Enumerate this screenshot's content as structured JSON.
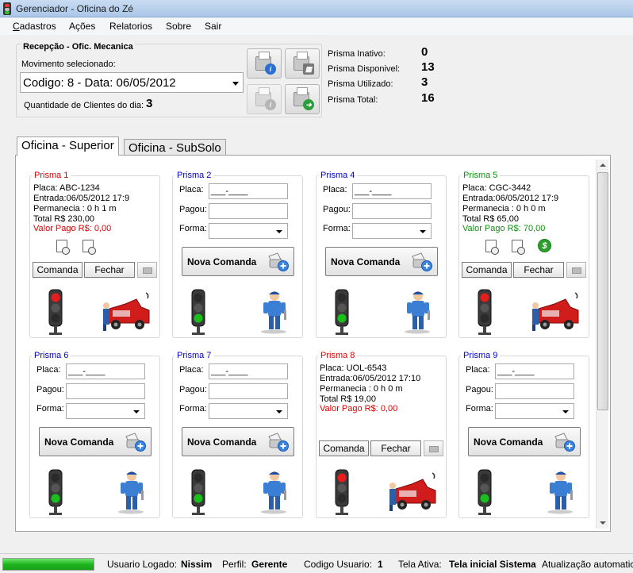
{
  "window": {
    "title": "Gerenciador - Oficina do Zé"
  },
  "menu": [
    "Cadastros",
    "Ações",
    "Relatorios",
    "Sobre",
    "Sair"
  ],
  "recepcao": {
    "group_title": "Recepção - Ofic. Mecanica",
    "movimento_label": "Movimento selecionado:",
    "movimento_value": "Codigo: 8 - Data: 06/05/2012",
    "qtd_label": "Quantidade de Clientes do dia:",
    "qtd_value": "3"
  },
  "stats": [
    {
      "label": "Prisma Inativo:",
      "value": "0"
    },
    {
      "label": "Prisma Disponivel:",
      "value": "13"
    },
    {
      "label": "Prisma Utilizado:",
      "value": "3"
    },
    {
      "label": "Prisma Total:",
      "value": "16"
    }
  ],
  "tabs": [
    "Oficina - Superior",
    "Oficina - SubSolo"
  ],
  "colors": {
    "red": "#e00000",
    "blue": "#0000c8",
    "green": "#109010"
  },
  "cards": [
    {
      "title": "Prisma 1",
      "placa": "Placa: ABC-1234",
      "entrada": "Entrada:06/05/2012 17:9",
      "permanencia": "Permanecia : 0 h 1 m",
      "total": "Total R$ 230,00",
      "valor_pago": "Valor Pago R$: 0,00",
      "comanda": "Comanda",
      "fechar": "Fechar"
    },
    {
      "title": "Prisma 2",
      "placa_label": "Placa:",
      "placa_mask": "___-____",
      "pagou_label": "Pagou:",
      "forma_label": "Forma:",
      "nova": "Nova Comanda"
    },
    {
      "title": "Prisma 4",
      "placa_label": "Placa:",
      "placa_mask": "___-____",
      "pagou_label": "Pagou:",
      "forma_label": "Forma:",
      "nova": "Nova Comanda"
    },
    {
      "title": "Prisma 5",
      "placa": "Placa: CGC-3442",
      "entrada": "Entrada:06/05/2012 17:9",
      "permanencia": "Permanecia : 0 h 0 m",
      "total": "Total R$ 65,00",
      "valor_pago": "Valor Pago R$: 70,00",
      "comanda": "Comanda",
      "fechar": "Fechar"
    },
    {
      "title": "Prisma 6",
      "placa_label": "Placa:",
      "placa_mask": "___-____",
      "pagou_label": "Pagou:",
      "forma_label": "Forma:",
      "nova": "Nova Comanda"
    },
    {
      "title": "Prisma 7",
      "placa_label": "Placa:",
      "placa_mask": "___-____",
      "pagou_label": "Pagou:",
      "forma_label": "Forma:",
      "nova": "Nova Comanda"
    },
    {
      "title": "Prisma 8",
      "placa": "Placa: UOL-6543",
      "entrada": "Entrada:06/05/2012 17:10",
      "permanencia": "Permanecia : 0 h 0 m",
      "total": "Total R$ 19,00",
      "valor_pago": "Valor Pago R$: 0,00",
      "comanda": "Comanda",
      "fechar": "Fechar"
    },
    {
      "title": "Prisma 9",
      "placa_label": "Placa:",
      "placa_mask": "___-____",
      "pagou_label": "Pagou:",
      "forma_label": "Forma:",
      "nova": "Nova Comanda"
    }
  ],
  "status": {
    "progress_fraction": 1.0,
    "usuario_label": "Usuario Logado:",
    "usuario": "Nissim",
    "perfil_label": "Perfil:",
    "perfil": "Gerente",
    "codigo_label": "Codigo Usuario:",
    "codigo": "1",
    "tela_label": "Tela Ativa:",
    "tela": "Tela inicial Sistema",
    "atualizacao": "Atualização automatic"
  }
}
